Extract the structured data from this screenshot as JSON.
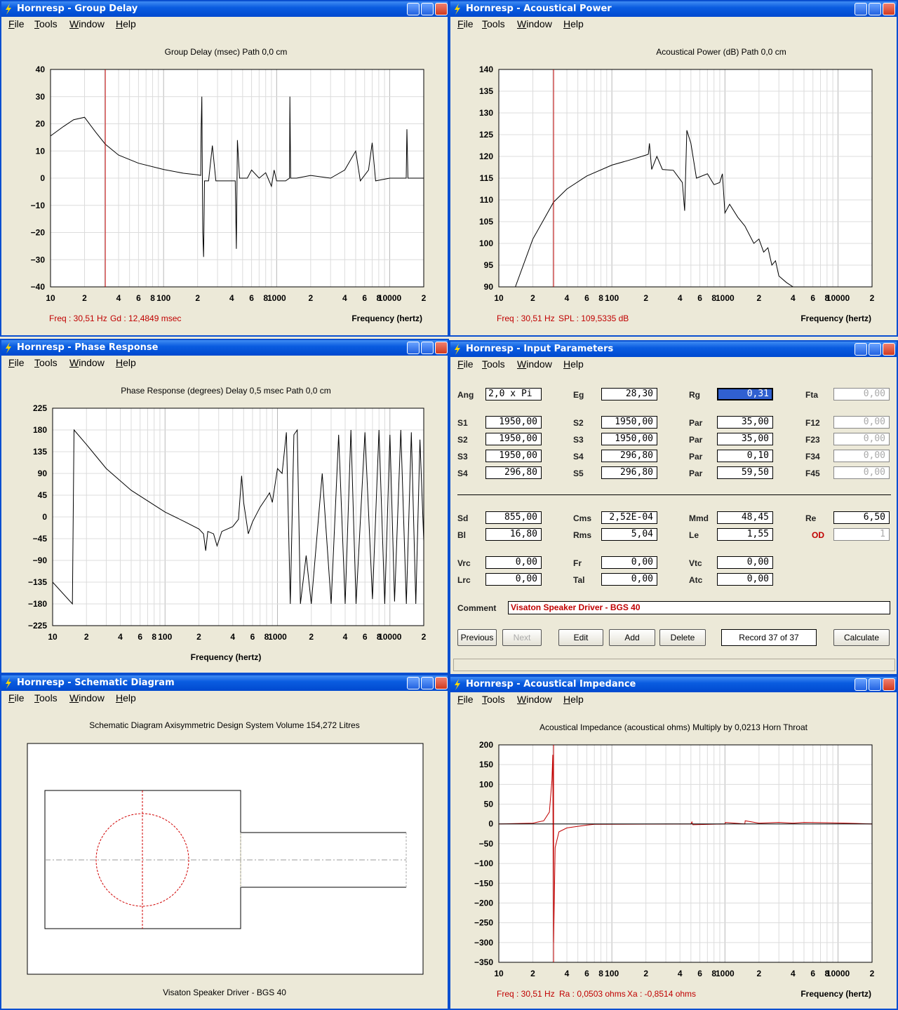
{
  "menu": [
    "File",
    "Tools",
    "Window",
    "Help"
  ],
  "windows": {
    "group_delay": {
      "title": "Hornresp - Group Delay",
      "header": "Group Delay (msec)    Path 0,0 cm",
      "xlabel": "Frequency (hertz)",
      "readout_freq": "Freq : 30,51 Hz",
      "readout_value": "Gd : 12,4849 msec"
    },
    "acoustical_power": {
      "title": "Hornresp - Acoustical Power",
      "header": "Acoustical Power (dB)    Path 0,0 cm",
      "xlabel": "Frequency (hertz)",
      "readout_freq": "Freq : 30,51 Hz",
      "readout_value": "SPL : 109,5335 dB"
    },
    "phase_response": {
      "title": "Hornresp - Phase Response",
      "header": "Phase Response (degrees)    Delay 0,5 msec    Path 0,0 cm",
      "xlabel": "Frequency (hertz)"
    },
    "input_parameters": {
      "title": "Hornresp - Input Parameters"
    },
    "schematic": {
      "title": "Hornresp - Schematic Diagram",
      "header": "Schematic Diagram    Axisymmetric Design    System Volume 154,272 Litres",
      "footer": "Visaton Speaker Driver - BGS 40"
    },
    "acoustical_impedance": {
      "title": "Hornresp - Acoustical Impedance",
      "header": "Acoustical Impedance (acoustical ohms)    Multiply by 0,0213    Horn Throat",
      "xlabel": "Frequency (hertz)",
      "readout_freq": "Freq : 30,51 Hz",
      "readout_ra": "Ra : 0,0503 ohms",
      "readout_xa": "Xa : -0,8514 ohms"
    }
  },
  "freq_ticks": [
    "10",
    "2",
    "4",
    "6",
    "8",
    "100",
    "2",
    "4",
    "6",
    "8",
    "1000",
    "2",
    "4",
    "6",
    "8",
    "10000",
    "2"
  ],
  "params": {
    "row1": [
      {
        "label": "Ang",
        "value": "2,0 x Pi"
      },
      {
        "label": "Eg",
        "value": "28,30"
      },
      {
        "label": "Rg",
        "value": "0,31"
      },
      {
        "label": "Fta",
        "value": "0,00"
      }
    ],
    "row2": [
      {
        "label": "S1",
        "value": "1950,00"
      },
      {
        "label": "S2",
        "value": "1950,00"
      },
      {
        "label": "Par",
        "value": "35,00"
      },
      {
        "label": "F12",
        "value": "0,00"
      }
    ],
    "row3": [
      {
        "label": "S2",
        "value": "1950,00"
      },
      {
        "label": "S3",
        "value": "1950,00"
      },
      {
        "label": "Par",
        "value": "35,00"
      },
      {
        "label": "F23",
        "value": "0,00"
      }
    ],
    "row4": [
      {
        "label": "S3",
        "value": "1950,00"
      },
      {
        "label": "S4",
        "value": "296,80"
      },
      {
        "label": "Par",
        "value": "0,10"
      },
      {
        "label": "F34",
        "value": "0,00"
      }
    ],
    "row5": [
      {
        "label": "S4",
        "value": "296,80"
      },
      {
        "label": "S5",
        "value": "296,80"
      },
      {
        "label": "Par",
        "value": "59,50"
      },
      {
        "label": "F45",
        "value": "0,00"
      }
    ],
    "row6": [
      {
        "label": "Sd",
        "value": "855,00"
      },
      {
        "label": "Cms",
        "value": "2,52E-04"
      },
      {
        "label": "Mmd",
        "value": "48,45"
      },
      {
        "label": "Re",
        "value": "6,50"
      }
    ],
    "row7": [
      {
        "label": "Bl",
        "value": "16,80"
      },
      {
        "label": "Rms",
        "value": "5,04"
      },
      {
        "label": "Le",
        "value": "1,55"
      },
      {
        "label": "OD",
        "value": "1"
      }
    ],
    "row8": [
      {
        "label": "Vrc",
        "value": "0,00"
      },
      {
        "label": "Fr",
        "value": "0,00"
      },
      {
        "label": "Vtc",
        "value": "0,00"
      }
    ],
    "row9": [
      {
        "label": "Lrc",
        "value": "0,00"
      },
      {
        "label": "Tal",
        "value": "0,00"
      },
      {
        "label": "Atc",
        "value": "0,00"
      }
    ],
    "comment_label": "Comment",
    "comment": "Visaton Speaker Driver - BGS 40",
    "buttons": {
      "previous": "Previous",
      "next": "Next",
      "edit": "Edit",
      "add": "Add",
      "delete": "Delete",
      "calculate": "Calculate"
    },
    "record": "Record 37 of 37"
  },
  "chart_data": [
    {
      "type": "line",
      "name": "group_delay",
      "xscale": "log",
      "xlim": [
        10,
        20000
      ],
      "ylim": [
        -40,
        40
      ],
      "yticks": [
        40,
        30,
        20,
        10,
        0,
        -10,
        -20,
        -30,
        -40
      ],
      "ylabel": "Group Delay (msec)",
      "xlabel": "Frequency (hertz)",
      "marker_x": 30.51,
      "points": [
        [
          10,
          15.5
        ],
        [
          13,
          19
        ],
        [
          16,
          21.5
        ],
        [
          20,
          22.4
        ],
        [
          25,
          17
        ],
        [
          30.51,
          12.5
        ],
        [
          40,
          8.5
        ],
        [
          60,
          5.5
        ],
        [
          100,
          3.2
        ],
        [
          150,
          1.8
        ],
        [
          200,
          1.2
        ],
        [
          213,
          1
        ],
        [
          215,
          18
        ],
        [
          218,
          30
        ],
        [
          222,
          -20
        ],
        [
          226,
          -29
        ],
        [
          230,
          -1
        ],
        [
          250,
          -1
        ],
        [
          270,
          12
        ],
        [
          290,
          -1
        ],
        [
          430,
          -1
        ],
        [
          440,
          -26
        ],
        [
          450,
          14
        ],
        [
          470,
          0
        ],
        [
          550,
          0
        ],
        [
          600,
          3
        ],
        [
          700,
          0
        ],
        [
          800,
          2
        ],
        [
          900,
          -3
        ],
        [
          950,
          3
        ],
        [
          1000,
          -1
        ],
        [
          1200,
          -1
        ],
        [
          1300,
          0
        ],
        [
          1310,
          30
        ],
        [
          1330,
          0
        ],
        [
          1500,
          0
        ],
        [
          2000,
          1
        ],
        [
          3000,
          0
        ],
        [
          4000,
          3
        ],
        [
          5000,
          10
        ],
        [
          5500,
          -1
        ],
        [
          6500,
          3
        ],
        [
          7000,
          13
        ],
        [
          7500,
          -1
        ],
        [
          10000,
          0
        ],
        [
          14000,
          0
        ],
        [
          14200,
          18
        ],
        [
          14500,
          0
        ],
        [
          20000,
          0
        ]
      ]
    },
    {
      "type": "line",
      "name": "acoustical_power",
      "xscale": "log",
      "xlim": [
        10,
        20000
      ],
      "ylim": [
        90,
        140
      ],
      "yticks": [
        140,
        135,
        130,
        125,
        120,
        115,
        110,
        105,
        100,
        95,
        90
      ],
      "ylabel": "Acoustical Power (dB)",
      "xlabel": "Frequency (hertz)",
      "marker_x": 30.51,
      "points": [
        [
          14,
          90
        ],
        [
          20,
          101
        ],
        [
          30.51,
          109.5
        ],
        [
          40,
          112.5
        ],
        [
          60,
          115.5
        ],
        [
          100,
          118
        ],
        [
          150,
          119.3
        ],
        [
          200,
          120.3
        ],
        [
          210,
          120.5
        ],
        [
          215,
          123
        ],
        [
          225,
          117
        ],
        [
          250,
          120
        ],
        [
          280,
          117
        ],
        [
          350,
          116.8
        ],
        [
          420,
          114
        ],
        [
          440,
          107.5
        ],
        [
          460,
          126
        ],
        [
          500,
          123
        ],
        [
          560,
          115
        ],
        [
          700,
          116
        ],
        [
          800,
          113.5
        ],
        [
          900,
          114
        ],
        [
          950,
          116
        ],
        [
          1000,
          107
        ],
        [
          1100,
          109
        ],
        [
          1300,
          106
        ],
        [
          1500,
          104
        ],
        [
          1800,
          100
        ],
        [
          2000,
          101
        ],
        [
          2200,
          98
        ],
        [
          2400,
          99
        ],
        [
          2600,
          95
        ],
        [
          2800,
          96
        ],
        [
          3000,
          92.5
        ],
        [
          3500,
          91
        ],
        [
          4000,
          90
        ]
      ]
    },
    {
      "type": "line",
      "name": "phase_response",
      "xscale": "log",
      "xlim": [
        10,
        20000
      ],
      "ylim": [
        -225,
        225
      ],
      "yticks": [
        225,
        180,
        135,
        90,
        45,
        0,
        -45,
        -90,
        -135,
        -180,
        -225
      ],
      "ylabel": "Phase Response (degrees)",
      "xlabel": "Frequency (hertz)",
      "points": [
        [
          10,
          -135
        ],
        [
          15,
          -180
        ],
        [
          15.5,
          180
        ],
        [
          20,
          150
        ],
        [
          30,
          100
        ],
        [
          50,
          55
        ],
        [
          100,
          10
        ],
        [
          150,
          -10
        ],
        [
          200,
          -25
        ],
        [
          220,
          -35
        ],
        [
          230,
          -70
        ],
        [
          240,
          -30
        ],
        [
          270,
          -35
        ],
        [
          290,
          -60
        ],
        [
          320,
          -30
        ],
        [
          400,
          -20
        ],
        [
          450,
          -5
        ],
        [
          480,
          85
        ],
        [
          500,
          30
        ],
        [
          550,
          -35
        ],
        [
          600,
          -10
        ],
        [
          700,
          20
        ],
        [
          800,
          40
        ],
        [
          850,
          50
        ],
        [
          900,
          30
        ],
        [
          1000,
          100
        ],
        [
          1100,
          90
        ],
        [
          1200,
          175
        ],
        [
          1300,
          -180
        ],
        [
          1400,
          170
        ],
        [
          1500,
          180
        ],
        [
          1600,
          -180
        ],
        [
          1800,
          -80
        ],
        [
          2000,
          -180
        ],
        [
          2500,
          90
        ],
        [
          3000,
          -180
        ],
        [
          3500,
          170
        ],
        [
          4000,
          -180
        ],
        [
          4500,
          180
        ],
        [
          5000,
          -180
        ],
        [
          6000,
          175
        ],
        [
          7000,
          -170
        ],
        [
          8000,
          180
        ],
        [
          9000,
          -180
        ],
        [
          10000,
          170
        ],
        [
          11000,
          -175
        ],
        [
          12500,
          180
        ],
        [
          14000,
          -180
        ],
        [
          15500,
          175
        ],
        [
          17000,
          -180
        ],
        [
          18500,
          160
        ],
        [
          20000,
          -50
        ]
      ]
    },
    {
      "type": "line",
      "name": "acoustical_impedance",
      "xscale": "log",
      "xlim": [
        10,
        20000
      ],
      "ylim": [
        -350,
        200
      ],
      "yticks": [
        200,
        150,
        100,
        50,
        0,
        -50,
        -100,
        -150,
        -200,
        -250,
        -300,
        -350
      ],
      "ylabel": "Acoustical Impedance (acoustical ohms)",
      "xlabel": "Frequency (hertz)",
      "marker_x": 30.51,
      "series": [
        {
          "name": "Ra",
          "points": [
            [
              10,
              0
            ],
            [
              20,
              2
            ],
            [
              25,
              8
            ],
            [
              28,
              30
            ],
            [
              29.5,
              110
            ],
            [
              30,
              175
            ],
            [
              30.5,
              -300
            ],
            [
              31,
              -180
            ],
            [
              31.5,
              -60
            ],
            [
              34,
              -20
            ],
            [
              40,
              -10
            ],
            [
              60,
              -3
            ],
            [
              70,
              -1
            ],
            [
              500,
              0
            ],
            [
              510,
              5
            ],
            [
              520,
              -2
            ],
            [
              1000,
              0
            ],
            [
              1010,
              4
            ],
            [
              1500,
              0
            ],
            [
              1510,
              8
            ],
            [
              2000,
              2
            ],
            [
              3000,
              4
            ],
            [
              4000,
              2
            ],
            [
              5000,
              4
            ],
            [
              8000,
              3
            ],
            [
              12000,
              2
            ],
            [
              20000,
              0
            ]
          ]
        }
      ]
    }
  ]
}
